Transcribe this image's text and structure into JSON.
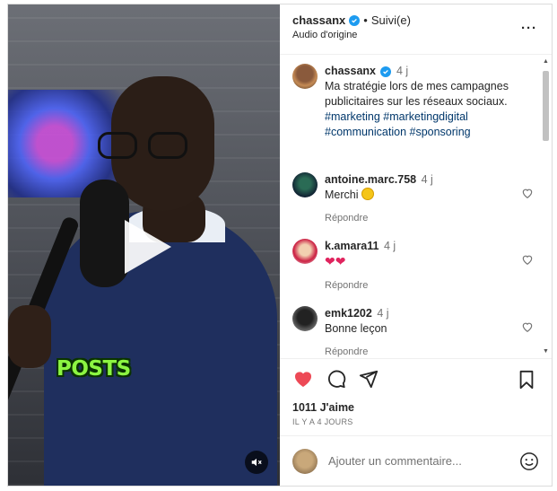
{
  "post": {
    "username": "chassanx",
    "follow_separator": "•",
    "follow_label": "Suivi(e)",
    "audio_label": "Audio d'origine",
    "more_label": "···"
  },
  "video": {
    "overlay_caption": "POSTS"
  },
  "caption": {
    "username": "chassanx",
    "time": "4 j",
    "text": "Ma stratégie lors de mes campagnes publicitaires sur les réseaux sociaux.",
    "hashtags_line1": "#marketing #marketingdigital",
    "hashtags_line2": "#communication #sponsoring"
  },
  "comments": [
    {
      "username": "antoine.marc.758",
      "time": "4 j",
      "text": "Merchi",
      "reply_label": "Répondre"
    },
    {
      "username": "k.amara11",
      "time": "4 j",
      "text": "",
      "reply_label": "Répondre"
    },
    {
      "username": "emk1202",
      "time": "4 j",
      "text": "Bonne leçon",
      "reply_label": "Répondre"
    }
  ],
  "actions": {
    "likes": "1011 J'aime",
    "time_ago": "IL Y A 4 JOURS"
  },
  "add_comment": {
    "placeholder": "Ajouter un commentaire..."
  },
  "colors": {
    "like_red": "#ed4956",
    "verified_blue": "#1d9bf0",
    "hashtag_blue": "#00376b",
    "caption_green": "#8cf542"
  },
  "icons": [
    "verified-icon",
    "more-icon",
    "play-icon",
    "mute-icon",
    "like-icon",
    "comment-icon",
    "share-icon",
    "save-icon",
    "emoji-icon"
  ]
}
